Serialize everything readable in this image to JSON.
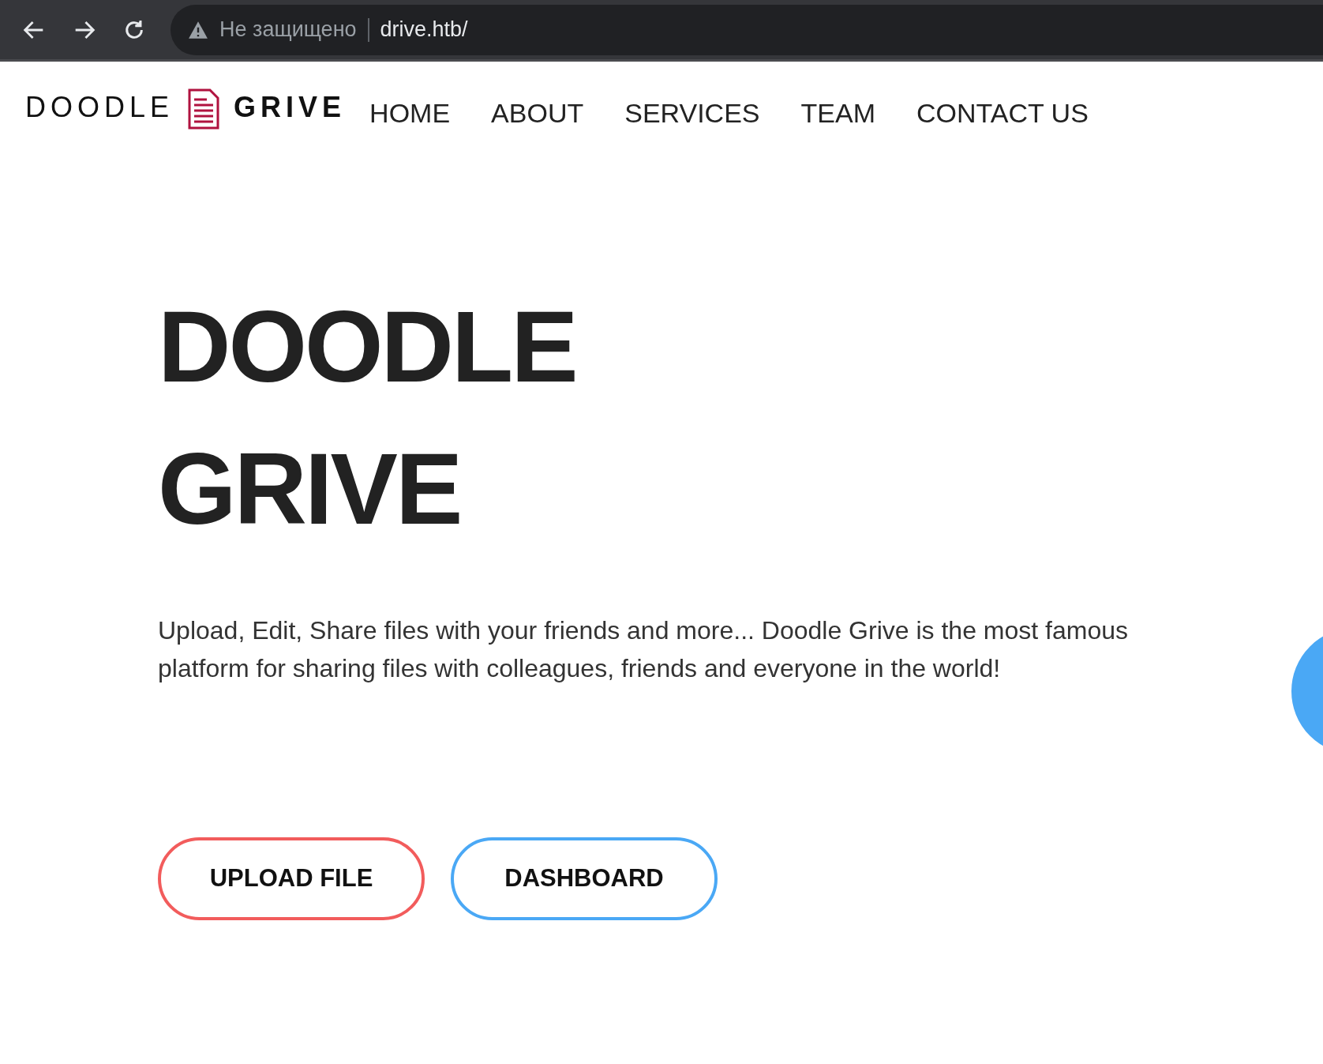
{
  "browser": {
    "security_label": "Не защищено",
    "url": "drive.htb/"
  },
  "logo": {
    "left": "DOODLE",
    "right": "GRIVE"
  },
  "nav": [
    "HOME",
    "ABOUT",
    "SERVICES",
    "TEAM",
    "CONTACT US"
  ],
  "hero": {
    "title_lines": [
      "DOODLE",
      "GRIVE"
    ],
    "text": "Upload, Edit, Share files with your friends and more... Doodle Grive is the most famous platform for sharing files with colleagues, friends and everyone in the world!"
  },
  "buttons": [
    {
      "label": "UPLOAD FILE",
      "color": "#f25c5c"
    },
    {
      "label": "DASHBOARD",
      "color": "#4aa8f5"
    }
  ]
}
